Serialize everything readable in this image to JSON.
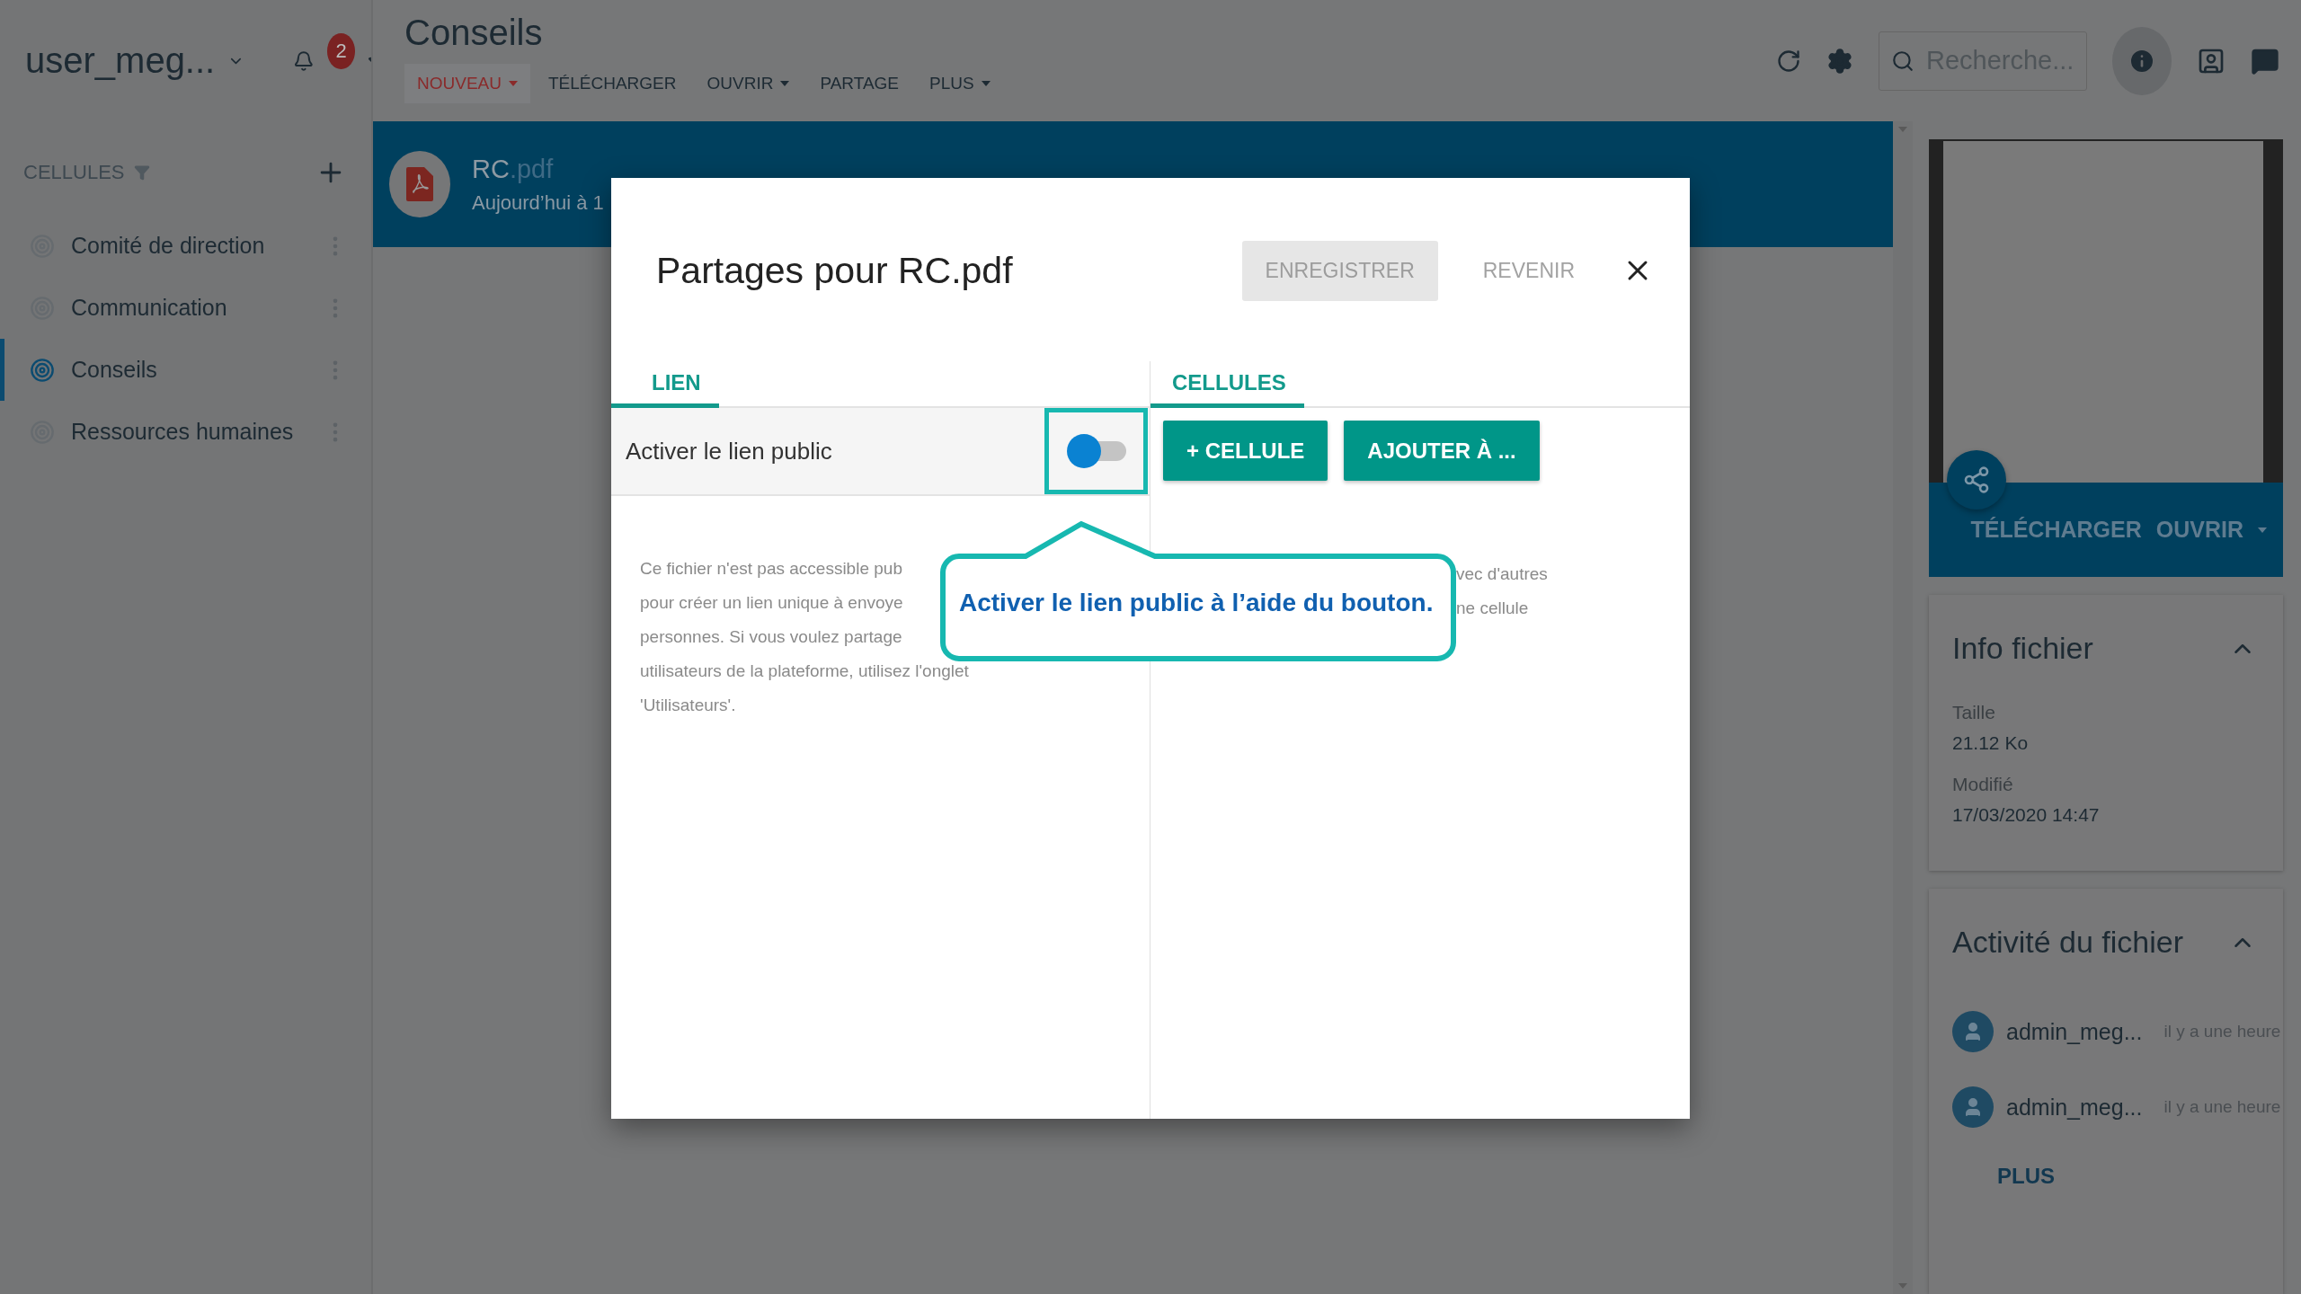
{
  "account": {
    "name": "user_meg...",
    "notification_count": "2"
  },
  "sidebar": {
    "heading": "CELLULES",
    "items": [
      {
        "label": "Comité de direction",
        "selected": false
      },
      {
        "label": "Communication",
        "selected": false
      },
      {
        "label": "Conseils",
        "selected": true
      },
      {
        "label": "Ressources humaines",
        "selected": false
      }
    ]
  },
  "header": {
    "title": "Conseils",
    "toolbar": [
      {
        "label": "NOUVEAU",
        "highlighted": true,
        "dropdown": true
      },
      {
        "label": "TÉLÉCHARGER",
        "highlighted": false,
        "dropdown": false
      },
      {
        "label": "OUVRIR",
        "highlighted": false,
        "dropdown": true
      },
      {
        "label": "PARTAGE",
        "highlighted": false,
        "dropdown": false
      },
      {
        "label": "PLUS",
        "highlighted": false,
        "dropdown": true
      }
    ]
  },
  "search": {
    "placeholder": "Recherche..."
  },
  "file": {
    "name": "RC",
    "extension": ".pdf",
    "date": "Aujourd’hui à 1"
  },
  "dialog": {
    "title": "Partages pour RC.pdf",
    "save_button": {
      "label": "ENREGISTRER",
      "disabled": true
    },
    "revert_button": "REVENIR",
    "link_section": {
      "heading": "LIEN",
      "toggle": {
        "label": "Activer le lien public",
        "on": false
      },
      "text_lines": [
        "Ce fichier n'est pas accessible pub",
        "pour créer un lien unique à envoye",
        "personnes. Si vous voulez partage",
        "utilisateurs de la plateforme, utilisez l'onglet",
        "'Utilisateurs'."
      ]
    },
    "cells_section": {
      "heading": "CELLULES",
      "buttons": [
        "+ CELLULE",
        "AJOUTER À ..."
      ],
      "text_lines": [
        "vec d'autres",
        "ne cellule"
      ]
    }
  },
  "callout": {
    "text": "Activer le lien public à l’aide du bouton."
  },
  "preview": {
    "actions": [
      "TÉLÉCHARGER",
      "OUVRIR"
    ]
  },
  "info": {
    "title": "Info fichier",
    "fields": [
      {
        "label": "Taille",
        "value": "21.12 Ko"
      },
      {
        "label": "Modifié",
        "value": "17/03/2020 14:47"
      }
    ]
  },
  "activity": {
    "title": "Activité du fichier",
    "entries": [
      {
        "user": "admin_meg...",
        "time": "il y a une heure"
      },
      {
        "user": "admin_meg...",
        "time": "il y a une heure"
      }
    ],
    "more": "PLUS"
  }
}
